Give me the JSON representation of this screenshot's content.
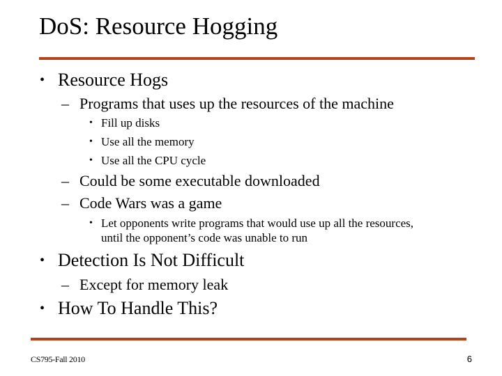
{
  "slide": {
    "title": "DoS: Resource Hogging",
    "accent_color": "#b5421a",
    "bullets": [
      {
        "level": 1,
        "marker": "•",
        "text": "Resource Hogs"
      },
      {
        "level": 2,
        "marker": "–",
        "text": "Programs that uses up the resources of the machine"
      },
      {
        "level": 3,
        "marker": "•",
        "text": "Fill up disks"
      },
      {
        "level": 3,
        "marker": "•",
        "text": "Use all the memory"
      },
      {
        "level": 3,
        "marker": "•",
        "text": "Use all the CPU cycle"
      },
      {
        "level": 2,
        "marker": "–",
        "text": "Could be some executable downloaded"
      },
      {
        "level": 2,
        "marker": "–",
        "text": "Code Wars was a game"
      },
      {
        "level": 3,
        "marker": "•",
        "text": "Let opponents write programs that would use up all the resources,",
        "continuation": "until the opponent’s code was unable to run"
      },
      {
        "level": 1,
        "marker": "•",
        "text": "Detection Is Not Difficult"
      },
      {
        "level": 2,
        "marker": "–",
        "text": "Except for memory leak"
      },
      {
        "level": 1,
        "marker": "•",
        "text": "How To Handle This?"
      }
    ]
  },
  "footer": {
    "course": "CS795-Fall 2010",
    "page_number": "6"
  }
}
